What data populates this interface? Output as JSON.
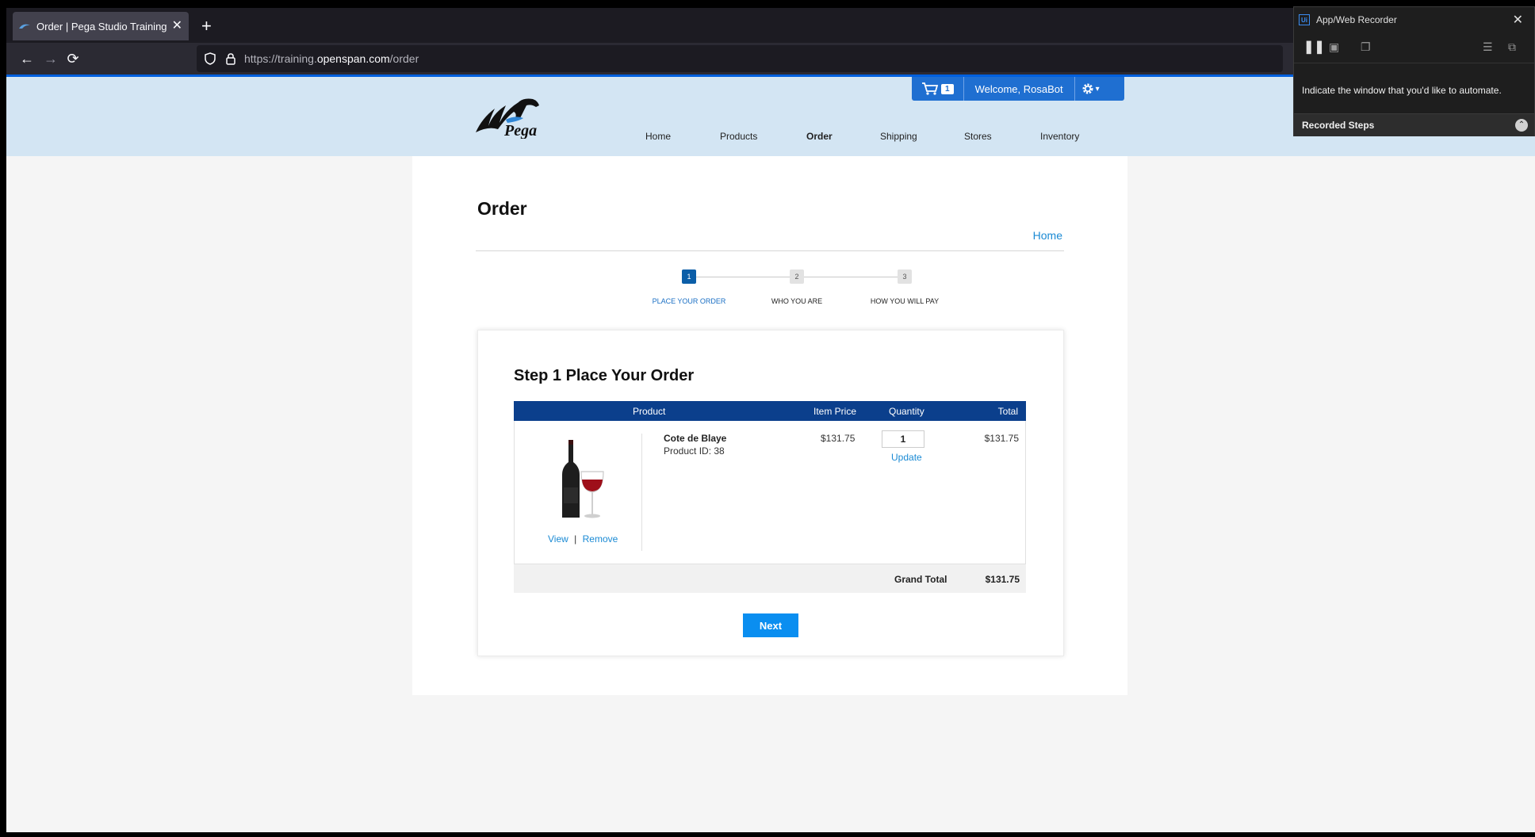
{
  "browser": {
    "tab_title": "Order | Pega Studio Training We",
    "tab_close": "✕",
    "new_tab": "+",
    "url_prefix": "https://training.",
    "url_host": "openspan.com",
    "url_path": "/order"
  },
  "header": {
    "cart_count": "1",
    "welcome": "Welcome, RosaBot",
    "settings_caret": "▾",
    "logo_text": "Pega",
    "nav": [
      {
        "label": "Home"
      },
      {
        "label": "Products"
      },
      {
        "label": "Order"
      },
      {
        "label": "Shipping"
      },
      {
        "label": "Stores"
      },
      {
        "label": "Inventory"
      }
    ]
  },
  "main": {
    "title": "Order",
    "breadcrumb_home": "Home",
    "steps": [
      {
        "number": "1",
        "label": "PLACE YOUR ORDER",
        "active": true
      },
      {
        "number": "2",
        "label": "WHO YOU ARE",
        "active": false
      },
      {
        "number": "3",
        "label": "HOW YOU WILL PAY",
        "active": false
      }
    ],
    "card_title": "Step 1 Place Your Order",
    "table": {
      "headers": {
        "product": "Product",
        "item_price": "Item Price",
        "quantity": "Quantity",
        "total": "Total"
      },
      "row": {
        "name": "Cote de Blaye",
        "product_id": "Product ID: 38",
        "view": "View",
        "separator": "|",
        "remove": "Remove",
        "item_price": "$131.75",
        "quantity": "1",
        "update": "Update",
        "total": "$131.75"
      },
      "grand_total_label": "Grand Total",
      "grand_total_value": "$131.75"
    },
    "next_button": "Next"
  },
  "recorder": {
    "title": "App/Web Recorder",
    "logo": "Ui",
    "message": "Indicate the window that you'd like to automate.",
    "recorded_steps": "Recorded Steps"
  },
  "colors": {
    "accent_blue": "#1f6fd1",
    "table_header": "#0b3f8c",
    "link": "#1a8ad4",
    "next_button": "#0a8ef0",
    "header_bg": "#d3e5f3"
  }
}
